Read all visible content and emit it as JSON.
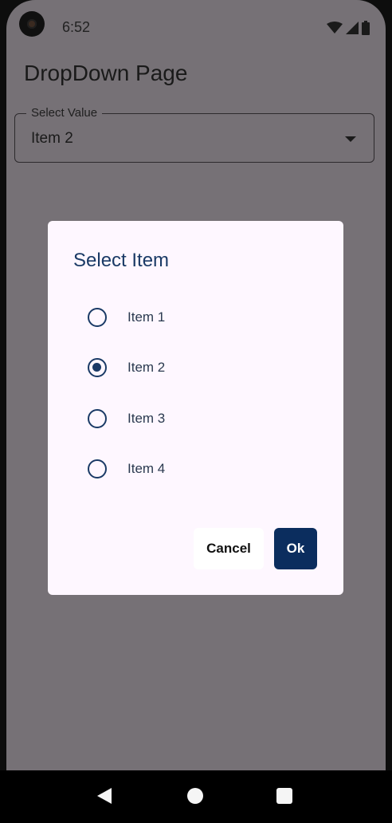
{
  "status_bar": {
    "time": "6:52",
    "icons": [
      "wifi-icon",
      "cellular-signal-icon",
      "battery-icon"
    ]
  },
  "app_bar": {
    "title": "DropDown Page"
  },
  "dropdown": {
    "label": "Select Value",
    "value": "Item 2",
    "icon": "dropdown-arrow-icon"
  },
  "dialog": {
    "title": "Select Item",
    "options": [
      {
        "label": "Item 1",
        "selected": false
      },
      {
        "label": "Item 2",
        "selected": true
      },
      {
        "label": "Item 3",
        "selected": false
      },
      {
        "label": "Item 4",
        "selected": false
      }
    ],
    "cancel_label": "Cancel",
    "ok_label": "Ok"
  },
  "nav_bar": {
    "icons": [
      "back-icon",
      "home-icon",
      "recents-icon"
    ]
  },
  "colors": {
    "scrim": "#767176",
    "dialog_background": "#fef7ff",
    "primary": "#0b2d5e",
    "dialog_title": "#1a3a66"
  }
}
